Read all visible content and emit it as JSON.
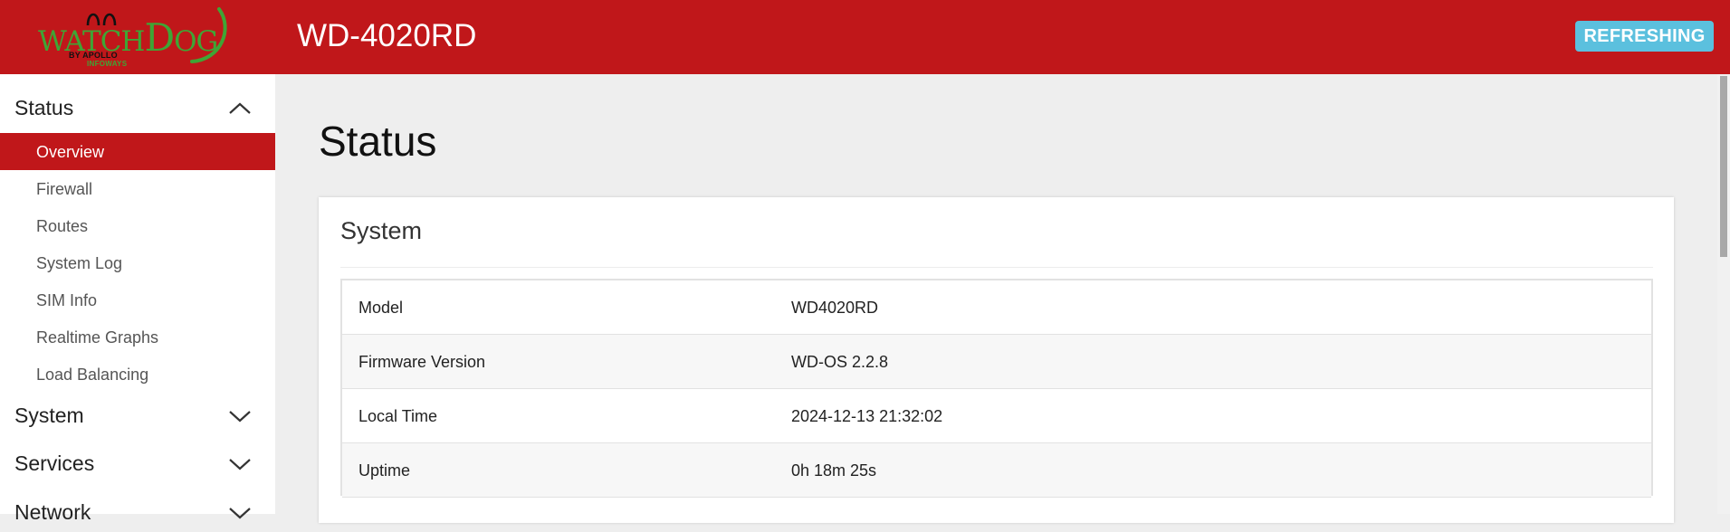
{
  "header": {
    "logo": {
      "main_pre": "WATCH",
      "main_big": "D",
      "main_post": "OG",
      "sub1": "BY APOLLO",
      "sub2": "INFOWAYS"
    },
    "device_title": "WD-4020RD",
    "refresh_label": "REFRESHING"
  },
  "colors": {
    "header_bg": "#c0171a",
    "logo_green": "#3fa535",
    "refresh_badge": "#5bc0de",
    "active_item": "#c0171a"
  },
  "sidebar": {
    "sections": [
      {
        "label": "Status",
        "expanded": true,
        "icon": "chevron-up-icon",
        "items": [
          {
            "label": "Overview",
            "active": true
          },
          {
            "label": "Firewall",
            "active": false
          },
          {
            "label": "Routes",
            "active": false
          },
          {
            "label": "System Log",
            "active": false
          },
          {
            "label": "SIM Info",
            "active": false
          },
          {
            "label": "Realtime Graphs",
            "active": false
          },
          {
            "label": "Load Balancing",
            "active": false
          }
        ]
      },
      {
        "label": "System",
        "expanded": false,
        "icon": "chevron-down-icon"
      },
      {
        "label": "Services",
        "expanded": false,
        "icon": "chevron-down-icon"
      },
      {
        "label": "Network",
        "expanded": false,
        "icon": "chevron-down-icon"
      }
    ]
  },
  "main": {
    "page_title": "Status",
    "system_panel": {
      "title": "System",
      "rows": [
        {
          "key": "Model",
          "value": "WD4020RD"
        },
        {
          "key": "Firmware Version",
          "value": "WD-OS 2.2.8"
        },
        {
          "key": "Local Time",
          "value": "2024-12-13 21:32:02"
        },
        {
          "key": "Uptime",
          "value": "0h 18m 25s"
        }
      ]
    }
  }
}
